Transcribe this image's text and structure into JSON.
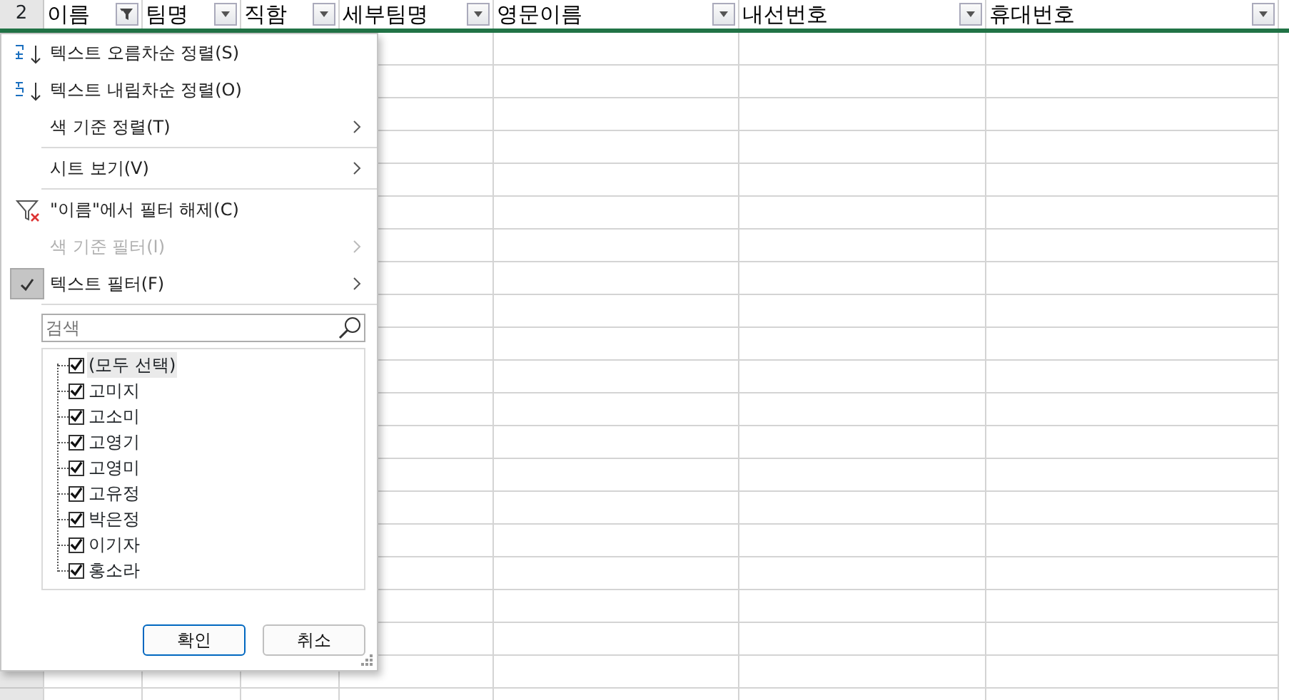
{
  "header": {
    "row_number": "2",
    "columns": [
      {
        "label": "이름",
        "filter_active": true
      },
      {
        "label": "팀명",
        "filter_active": false
      },
      {
        "label": "직함",
        "filter_active": false
      },
      {
        "label": "세부팀명",
        "filter_active": false
      },
      {
        "label": "영문이름",
        "filter_active": false
      },
      {
        "label": "내선번호",
        "filter_active": false
      },
      {
        "label": "휴대번호",
        "filter_active": false
      }
    ]
  },
  "filter_menu": {
    "items": [
      {
        "kind": "sort-asc",
        "label": "텍스트 오름차순 정렬(S)",
        "checked": false,
        "disabled": false
      },
      {
        "kind": "sort-desc",
        "label": "텍스트 내림차순 정렬(O)",
        "checked": false,
        "disabled": false
      },
      {
        "kind": "submenu",
        "label": "색 기준 정렬(T)",
        "checked": false,
        "disabled": false
      },
      {
        "kind": "separator"
      },
      {
        "kind": "submenu",
        "label": "시트 보기(V)",
        "checked": false,
        "disabled": false
      },
      {
        "kind": "separator"
      },
      {
        "kind": "clear-filter",
        "label": "\"이름\"에서 필터 해제(C)",
        "checked": false,
        "disabled": false
      },
      {
        "kind": "submenu",
        "label": "색 기준 필터(I)",
        "checked": false,
        "disabled": true
      },
      {
        "kind": "submenu",
        "label": "텍스트 필터(F)",
        "checked": true,
        "disabled": false
      },
      {
        "kind": "separator"
      }
    ],
    "search": {
      "placeholder": "검색"
    },
    "values": [
      {
        "label": "(모두 선택)",
        "checked": true,
        "selected": true
      },
      {
        "label": "고미지",
        "checked": true,
        "selected": false
      },
      {
        "label": "고소미",
        "checked": true,
        "selected": false
      },
      {
        "label": "고영기",
        "checked": true,
        "selected": false
      },
      {
        "label": "고영미",
        "checked": true,
        "selected": false
      },
      {
        "label": "고유정",
        "checked": true,
        "selected": false
      },
      {
        "label": "박은정",
        "checked": true,
        "selected": false
      },
      {
        "label": "이기자",
        "checked": true,
        "selected": false
      },
      {
        "label": "홍소라",
        "checked": true,
        "selected": false
      }
    ],
    "buttons": [
      {
        "label": "확인",
        "kind": "primary"
      },
      {
        "label": "취소",
        "kind": "secondary"
      }
    ]
  }
}
